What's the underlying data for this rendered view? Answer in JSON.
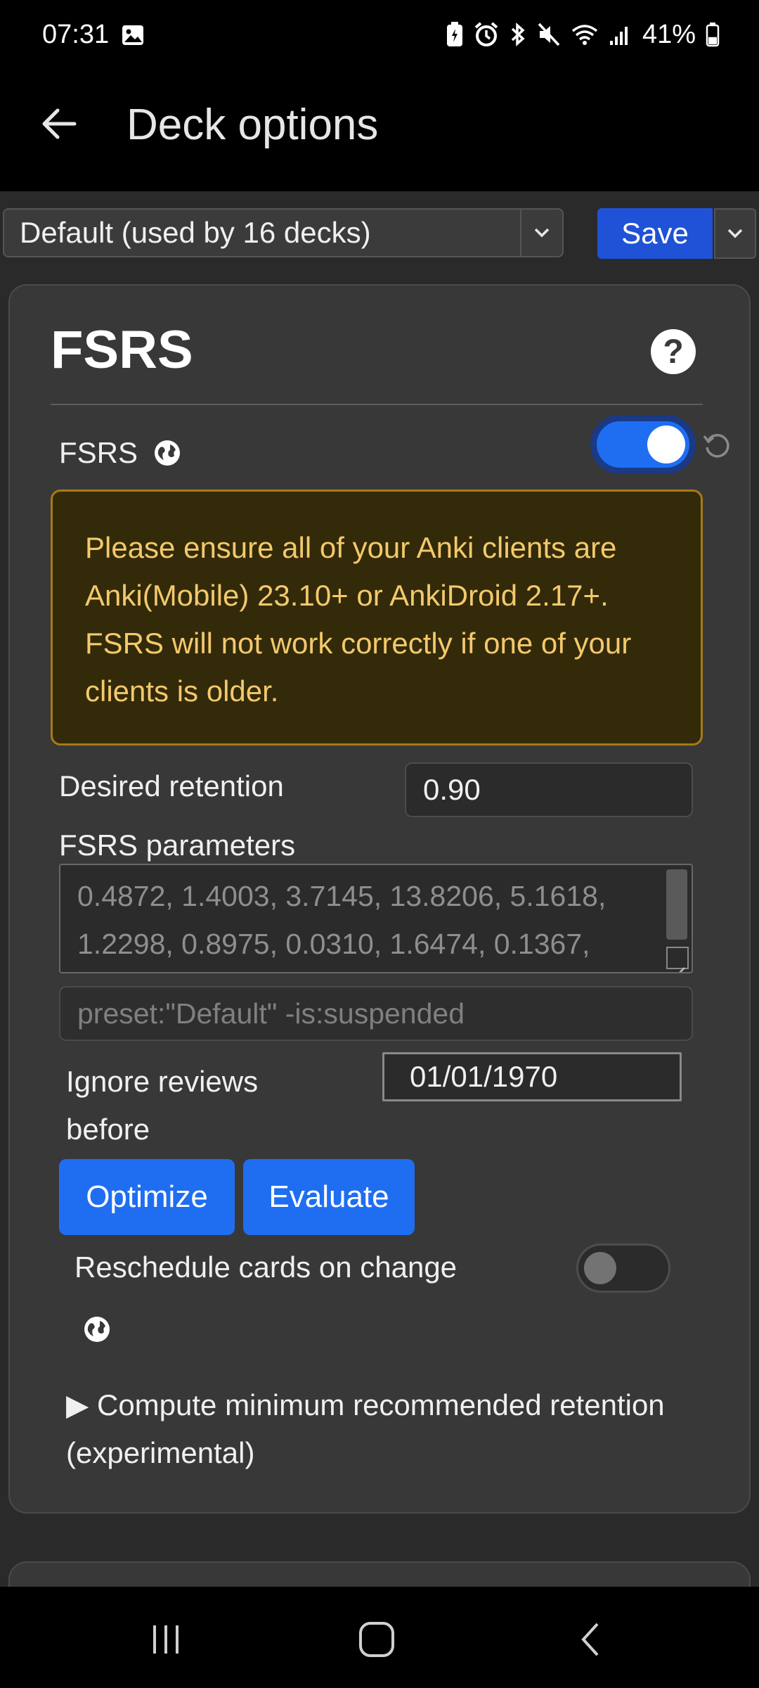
{
  "status_bar": {
    "time": "07:31",
    "battery_percent": "41%",
    "battery_level": 0.41,
    "icons": [
      "image-icon",
      "battery-saver-icon",
      "alarm-icon",
      "bluetooth-icon",
      "mute-icon",
      "wifi-icon",
      "signal-icon",
      "battery-icon"
    ]
  },
  "app_bar": {
    "title": "Deck options",
    "back_icon": "arrow-left-icon"
  },
  "preset_bar": {
    "selected_preset": "Default (used by 16 decks)",
    "save_label": "Save",
    "accent": "#1f52d6"
  },
  "fsrs_section": {
    "title": "FSRS",
    "help_icon": "?",
    "fsrs_toggle_label": "FSRS",
    "fsrs_enabled": true,
    "warning": "Please ensure all of your Anki clients are Anki(Mobile) 23.10+ or AnkiDroid 2.17+. FSRS will not work correctly if one of your clients is older.",
    "desired_retention_label": "Desired retention",
    "desired_retention_value": "0.90",
    "parameters_label": "FSRS parameters",
    "parameters_line1": "0.4872, 1.4003, 3.7145, 13.8206, 5.1618,",
    "parameters_line2": "1.2298, 0.8975, 0.0310, 1.6474, 0.1367,",
    "search_placeholder": "preset:\"Default\" -is:suspended",
    "ignore_reviews_label_line1": "Ignore reviews",
    "ignore_reviews_label_line2": "before",
    "ignore_reviews_date": "01/01/1970",
    "optimize_label": "Optimize",
    "evaluate_label": "Evaluate",
    "reschedule_label": "Reschedule cards on change",
    "reschedule_enabled": false,
    "compute_label": "Compute minimum recommended retention (experimental)",
    "button_color": "#1f6ef2",
    "warning_text_color": "#f3c96b"
  },
  "nav_bar": {
    "buttons": [
      "recents-icon",
      "home-icon",
      "back-icon"
    ]
  }
}
